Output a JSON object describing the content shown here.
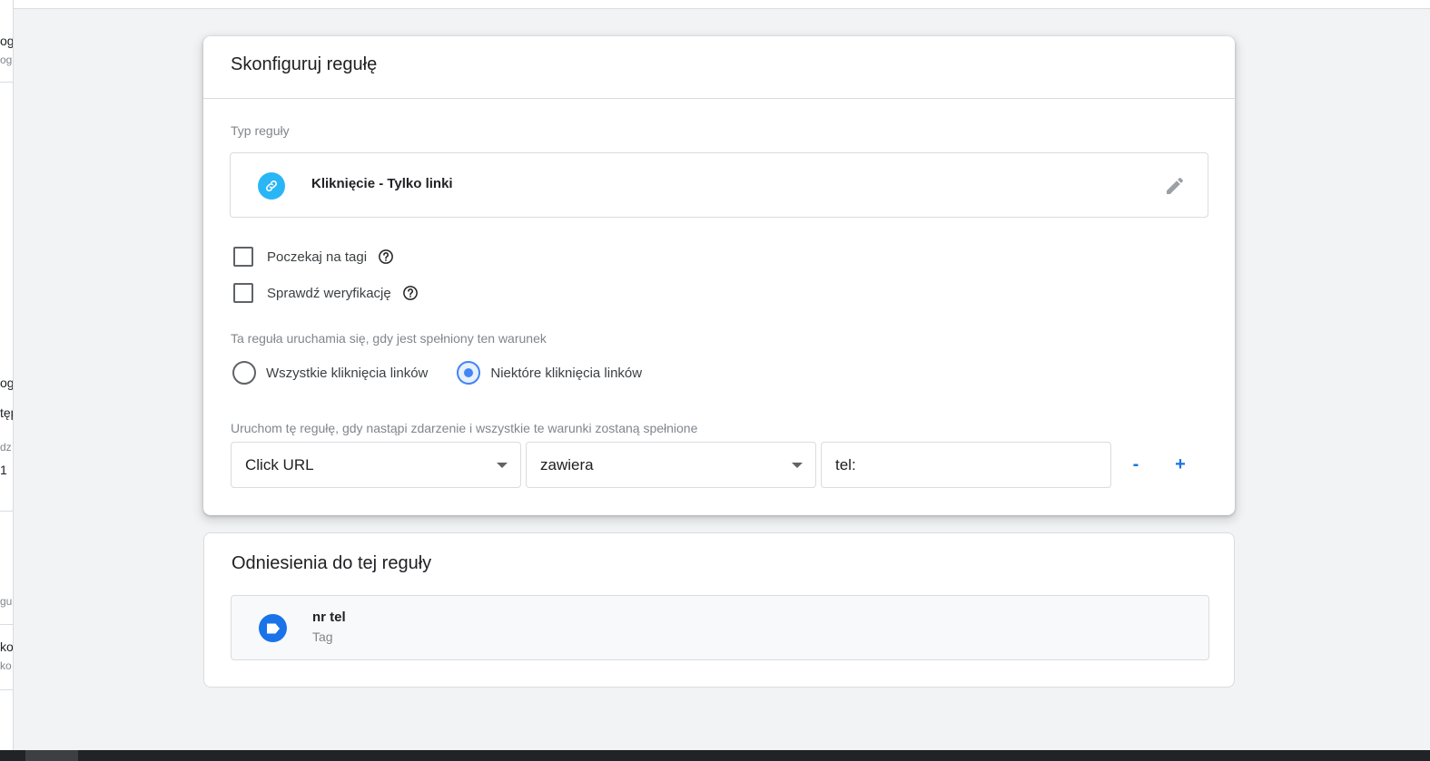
{
  "left_panel": {
    "fragments": [
      {
        "text": "og",
        "kind": "main"
      },
      {
        "text": "ogl",
        "kind": "sub"
      },
      {
        "text": "ogl",
        "kind": "main"
      },
      {
        "text": "tęp",
        "kind": "main"
      },
      {
        "text": "dz",
        "kind": "sub"
      },
      {
        "text": "1",
        "kind": "main"
      },
      {
        "text": "gu",
        "kind": "sub"
      },
      {
        "text": "ko",
        "kind": "main"
      },
      {
        "text": "ko",
        "kind": "sub"
      }
    ]
  },
  "config": {
    "title": "Skonfiguruj regułę",
    "trigger_type_label": "Typ reguły",
    "trigger_type": {
      "name": "Kliknięcie - Tylko linki",
      "icon": "link-icon",
      "edit_icon": "pencil-icon"
    },
    "checkboxes": [
      {
        "label": "Poczekaj na tagi",
        "checked": false,
        "help_icon": "help-icon"
      },
      {
        "label": "Sprawdź weryfikację",
        "checked": false,
        "help_icon": "help-icon"
      }
    ],
    "fires_label": "Ta reguła uruchamia się, gdy jest spełniony ten warunek",
    "radio_options": [
      {
        "label": "Wszystkie kliknięcia linków",
        "selected": false
      },
      {
        "label": "Niektóre kliknięcia linków",
        "selected": true
      }
    ],
    "condition_label": "Uruchom tę regułę, gdy nastąpi zdarzenie i wszystkie te warunki zostaną spełnione",
    "condition": {
      "variable": "Click URL",
      "operator": "zawiera",
      "value": "tel:",
      "remove_label": "-",
      "add_label": "+"
    }
  },
  "references": {
    "title": "Odniesienia do tej reguły",
    "items": [
      {
        "name": "nr tel",
        "type": "Tag",
        "icon": "tag-icon"
      }
    ]
  },
  "colors": {
    "trigger_icon_bg": "#29b6f6",
    "tag_icon_bg": "#1a73e8",
    "accent": "#4285f4",
    "page_bg": "#f1f3f4"
  }
}
